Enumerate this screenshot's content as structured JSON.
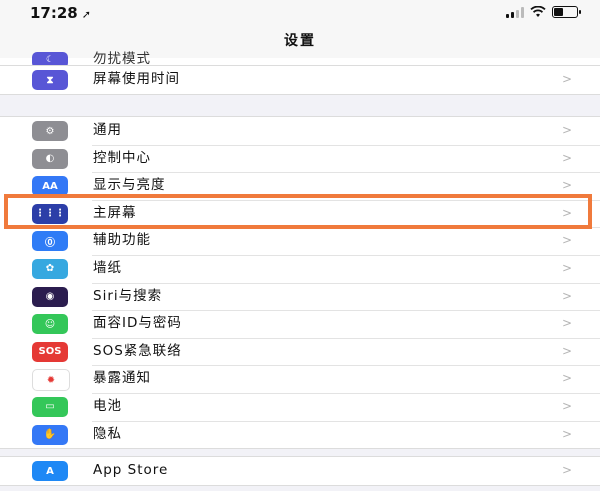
{
  "status_bar": {
    "time": "17:28",
    "location_glyph": "➚"
  },
  "nav": {
    "title": "设置"
  },
  "partial_row": {
    "label": "勿扰模式",
    "icon": "moon-icon",
    "color": "#5856d6",
    "chevron": ">"
  },
  "groups": [
    {
      "items": [
        {
          "label": "屏幕使用时间",
          "icon": "hourglass-icon",
          "color": "#5856d6",
          "glyph": "⧗",
          "chevron": ">"
        }
      ]
    },
    {
      "items": [
        {
          "label": "通用",
          "icon": "gear-icon",
          "color": "#8e8e93",
          "glyph": "⚙",
          "chevron": ">"
        },
        {
          "label": "控制中心",
          "icon": "toggles-icon",
          "color": "#8e8e93",
          "glyph": "◐",
          "chevron": ">"
        },
        {
          "label": "显示与亮度",
          "icon": "text-size-icon",
          "color": "#3478f6",
          "glyph": "AA",
          "chevron": ">"
        },
        {
          "label": "主屏幕",
          "icon": "home-screen-grid-icon",
          "color": "#2c3ea8",
          "glyph": "⋮⋮⋮",
          "chevron": ">"
        },
        {
          "label": "辅助功能",
          "icon": "accessibility-icon",
          "color": "#2f7cf6",
          "glyph": "⓪",
          "chevron": ">"
        },
        {
          "label": "墙纸",
          "icon": "wallpaper-flower-icon",
          "color": "#36a8e0",
          "glyph": "✿",
          "chevron": ">"
        },
        {
          "label": "Siri与搜索",
          "icon": "siri-icon",
          "color": "#2b1d4f",
          "glyph": "◉",
          "chevron": ">"
        },
        {
          "label": "面容ID与密码",
          "icon": "face-id-icon",
          "color": "#34c759",
          "glyph": "☺",
          "chevron": ">"
        },
        {
          "label": "SOS紧急联络",
          "icon": "sos-icon",
          "color": "#e53935",
          "glyph": "SOS",
          "chevron": ">"
        },
        {
          "label": "暴露通知",
          "icon": "exposure-notification-icon",
          "color": "#ffffff",
          "glyph": "✹",
          "glyph_color": "#e53935",
          "chevron": ">"
        },
        {
          "label": "电池",
          "icon": "battery-icon",
          "color": "#34c759",
          "glyph": "▭",
          "chevron": ">"
        },
        {
          "label": "隐私",
          "icon": "privacy-hand-icon",
          "color": "#3478f6",
          "glyph": "✋",
          "chevron": ">"
        }
      ]
    },
    {
      "items": [
        {
          "label": "App Store",
          "icon": "app-store-icon",
          "color": "#1e88f5",
          "glyph": "A",
          "chevron": ">"
        }
      ]
    }
  ],
  "highlight": {
    "target": "主屏幕",
    "color": "#f07a3c"
  }
}
